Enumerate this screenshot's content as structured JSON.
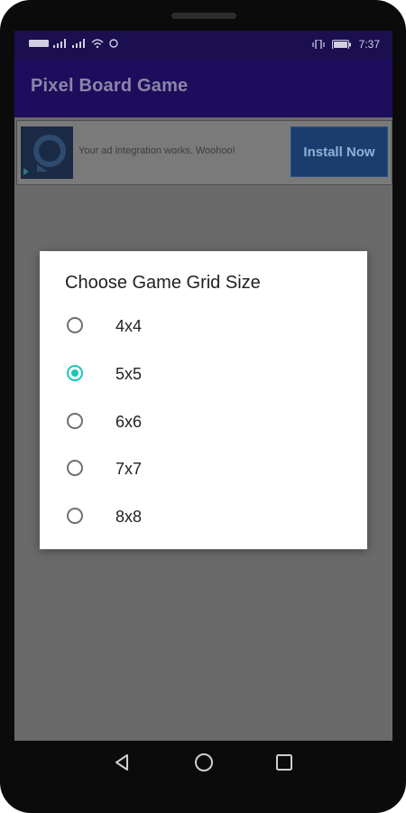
{
  "status_bar": {
    "time": "7:37",
    "icons": [
      "carrier-icon",
      "signal-icon",
      "signal-icon",
      "wifi-icon",
      "notification-icon",
      "vibrate-icon",
      "battery-icon"
    ]
  },
  "app_bar": {
    "title": "Pixel Board Game"
  },
  "ad_banner": {
    "text": "Your ad integration works. Woohoo!",
    "button_label": "Install Now"
  },
  "dialog": {
    "title": "Choose Game Grid Size",
    "options": [
      {
        "label": "4x4",
        "selected": false
      },
      {
        "label": "5x5",
        "selected": true
      },
      {
        "label": "6x6",
        "selected": false
      },
      {
        "label": "7x7",
        "selected": false
      },
      {
        "label": "8x8",
        "selected": false
      }
    ]
  },
  "nav_bar": {
    "buttons": [
      "back-icon",
      "home-icon",
      "recents-icon"
    ]
  },
  "colors": {
    "status_bar": "#1b0f4f",
    "app_bar": "#1e0d5c",
    "scrim": "#6a6a6a",
    "radio_accent": "#19c4bd",
    "ad_button": "#1b3d6e"
  }
}
